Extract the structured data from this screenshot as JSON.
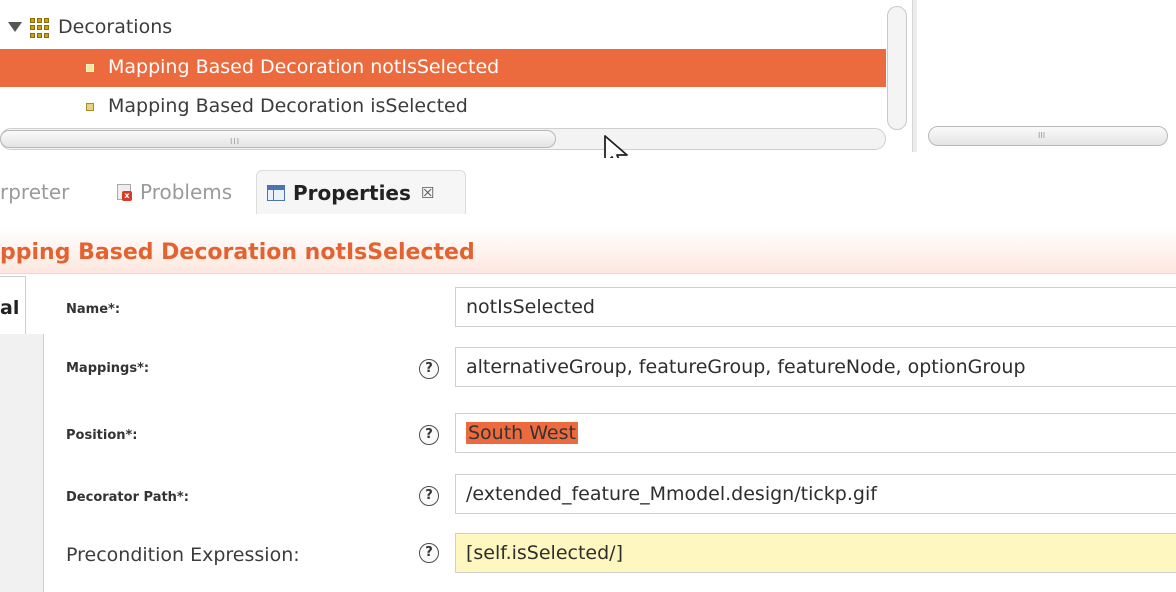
{
  "tree": {
    "group_label": "Decorations",
    "items": [
      {
        "label": "Mapping Based Decoration notIsSelected",
        "selected": true
      },
      {
        "label": "Mapping Based Decoration isSelected",
        "selected": false
      }
    ],
    "scroll_grip": "III"
  },
  "tabs": [
    {
      "label": "rpreter",
      "icon": "",
      "active": false
    },
    {
      "label": "Problems",
      "icon": "problems-icon",
      "active": false
    },
    {
      "label": "Properties",
      "icon": "properties-icon",
      "active": true,
      "close": "☒"
    }
  ],
  "properties": {
    "title": "pping Based Decoration notIsSelected",
    "section_tab_label": "al",
    "fields": [
      {
        "label": "Name*:",
        "value": "notIsSelected",
        "help": ""
      },
      {
        "label": "Mappings*:",
        "value": "alternativeGroup, featureGroup, featureNode, optionGroup",
        "help": "?"
      },
      {
        "label": "Position*:",
        "value": "South West",
        "help": "?"
      },
      {
        "label": "Decorator Path*:",
        "value": "/extended_feature_Mmodel.design/tickp.gif",
        "help": "?"
      },
      {
        "label": "Precondition Expression:",
        "value": "[self.isSelected/]",
        "help": "?"
      }
    ]
  },
  "colors": {
    "accent": "#ec6b3e",
    "title": "#e4622f",
    "expression_bg": "#fff7c0"
  }
}
